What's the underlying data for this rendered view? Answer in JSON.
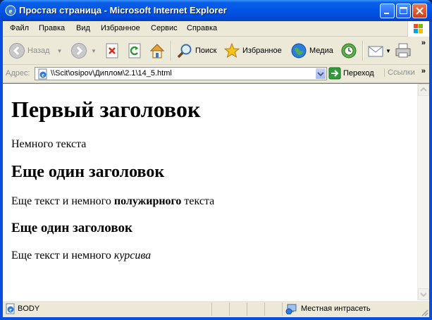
{
  "window": {
    "title": "Простая страница - Microsoft Internet Explorer"
  },
  "menu": [
    "Файл",
    "Правка",
    "Вид",
    "Избранное",
    "Сервис",
    "Справка"
  ],
  "toolbar": {
    "back_label": "Назад",
    "search_label": "Поиск",
    "favorites_label": "Избранное",
    "media_label": "Медиа"
  },
  "address_bar": {
    "label": "Адрес:",
    "url": "\\\\Scit\\osipov\\Диплом\\2.1\\14_5.html",
    "go_label": "Переход",
    "links_label": "Ссылки"
  },
  "page": {
    "h1": "Первый заголовок",
    "p1": "Немного текста",
    "h2": "Еще один заголовок",
    "p2_before": "Еще текст и немного ",
    "p2_bold": "полужирного",
    "p2_after": " текста",
    "h3": "Еще один заголовок",
    "p3_before": "Еще текст и немного ",
    "p3_italic": "курсива"
  },
  "status_bar": {
    "left_text": "BODY",
    "zone_text": "Местная интрасеть"
  },
  "colors": {
    "titlebar": "#0055e5",
    "chrome": "#ece9d8"
  }
}
